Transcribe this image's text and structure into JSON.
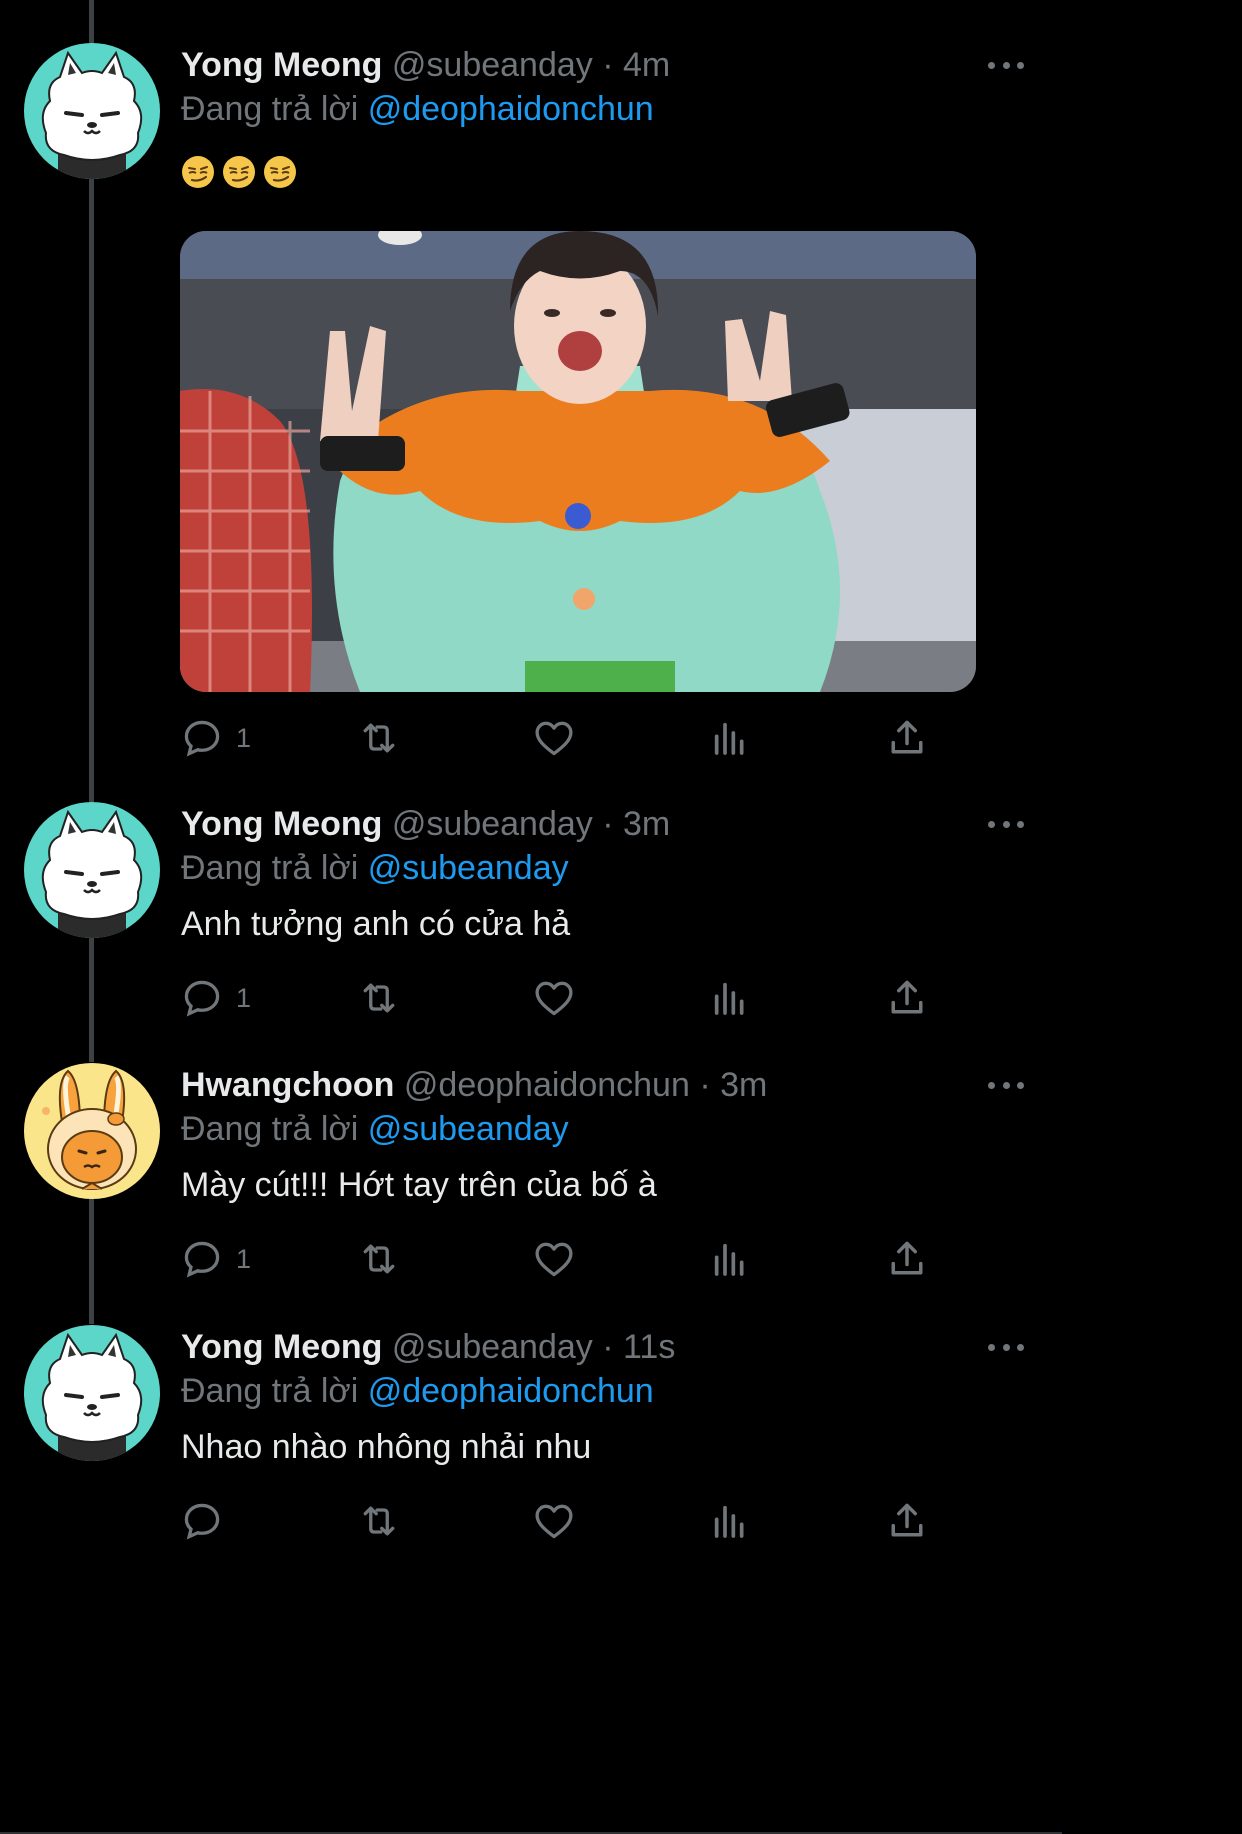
{
  "tweets": [
    {
      "name": "Yong Meong",
      "handle": "@subeanday",
      "time": "· 4m",
      "reply_label": "Đang trả lời",
      "reply_to": "@deophaidonchun",
      "text": "",
      "emoji": [
        "😏",
        "😏",
        "😏"
      ],
      "has_media": true,
      "reply_count": "1",
      "avatar": "white-fox-on-teal"
    },
    {
      "name": "Yong Meong",
      "handle": "@subeanday",
      "time": "· 3m",
      "reply_label": "Đang trả lời",
      "reply_to": "@subeanday",
      "text": "Anh tưởng anh có cửa hả",
      "reply_count": "1",
      "avatar": "white-fox-on-teal"
    },
    {
      "name": "Hwangchoon",
      "handle": "@deophaidonchun",
      "time": "· 3m",
      "reply_label": "Đang trả lời",
      "reply_to": "@subeanday",
      "text": "Mày cút!!! Hớt tay trên của bố à",
      "reply_count": "1",
      "avatar": "orange-bunny-on-yellow"
    },
    {
      "name": "Yong Meong",
      "handle": "@subeanday",
      "time": "· 11s",
      "reply_label": "Đang trả lời",
      "reply_to": "@deophaidonchun",
      "text": "Nhao nhào nhông nhải nhu",
      "reply_count": "",
      "avatar": "white-fox-on-teal"
    }
  ],
  "icons": {
    "reply": "speech-bubble-icon",
    "retweet": "retweet-icon",
    "like": "heart-icon",
    "views": "bar-chart-icon",
    "share": "share-upload-icon",
    "more": "more-dots-icon"
  },
  "colors": {
    "background": "#000000",
    "text": "#e7e9ea",
    "secondary": "#71767b",
    "mention": "#1d9bf0",
    "thread_line": "#3e4144",
    "teal_avatar": "#5cd6c8",
    "yellow_avatar": "#fbe58a"
  }
}
